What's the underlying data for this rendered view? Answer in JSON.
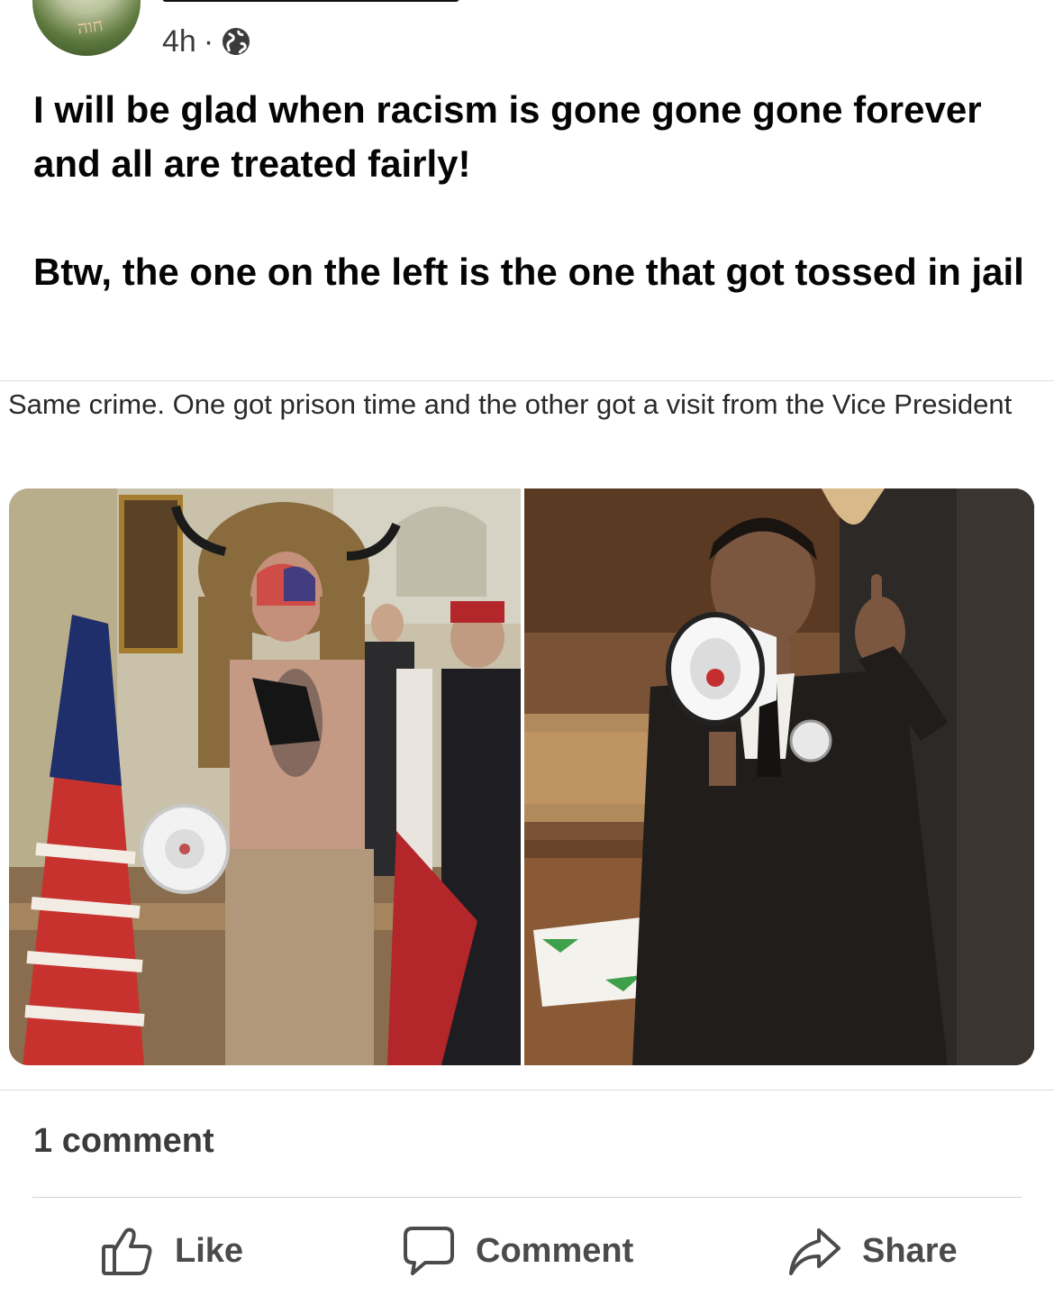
{
  "post": {
    "timestamp": "4h",
    "separator": "·",
    "visibility_icon": "globe-icon",
    "avatar_text": "חוה",
    "text": [
      "I will be glad when racism is gone gone gone forever and all are treated fairly!",
      "Btw, the one on the left is the one that got tossed in jail"
    ]
  },
  "shared": {
    "caption": "Same crime. One got prison time and the other got a visit from the Vice President"
  },
  "stats": {
    "comments": "1 comment"
  },
  "actions": {
    "like": "Like",
    "comment": "Comment",
    "share": "Share"
  },
  "colors": {
    "text": "#050505",
    "secondary": "#3a3b3c",
    "action": "#4a4b4d",
    "divider": "#d0d2d6"
  }
}
